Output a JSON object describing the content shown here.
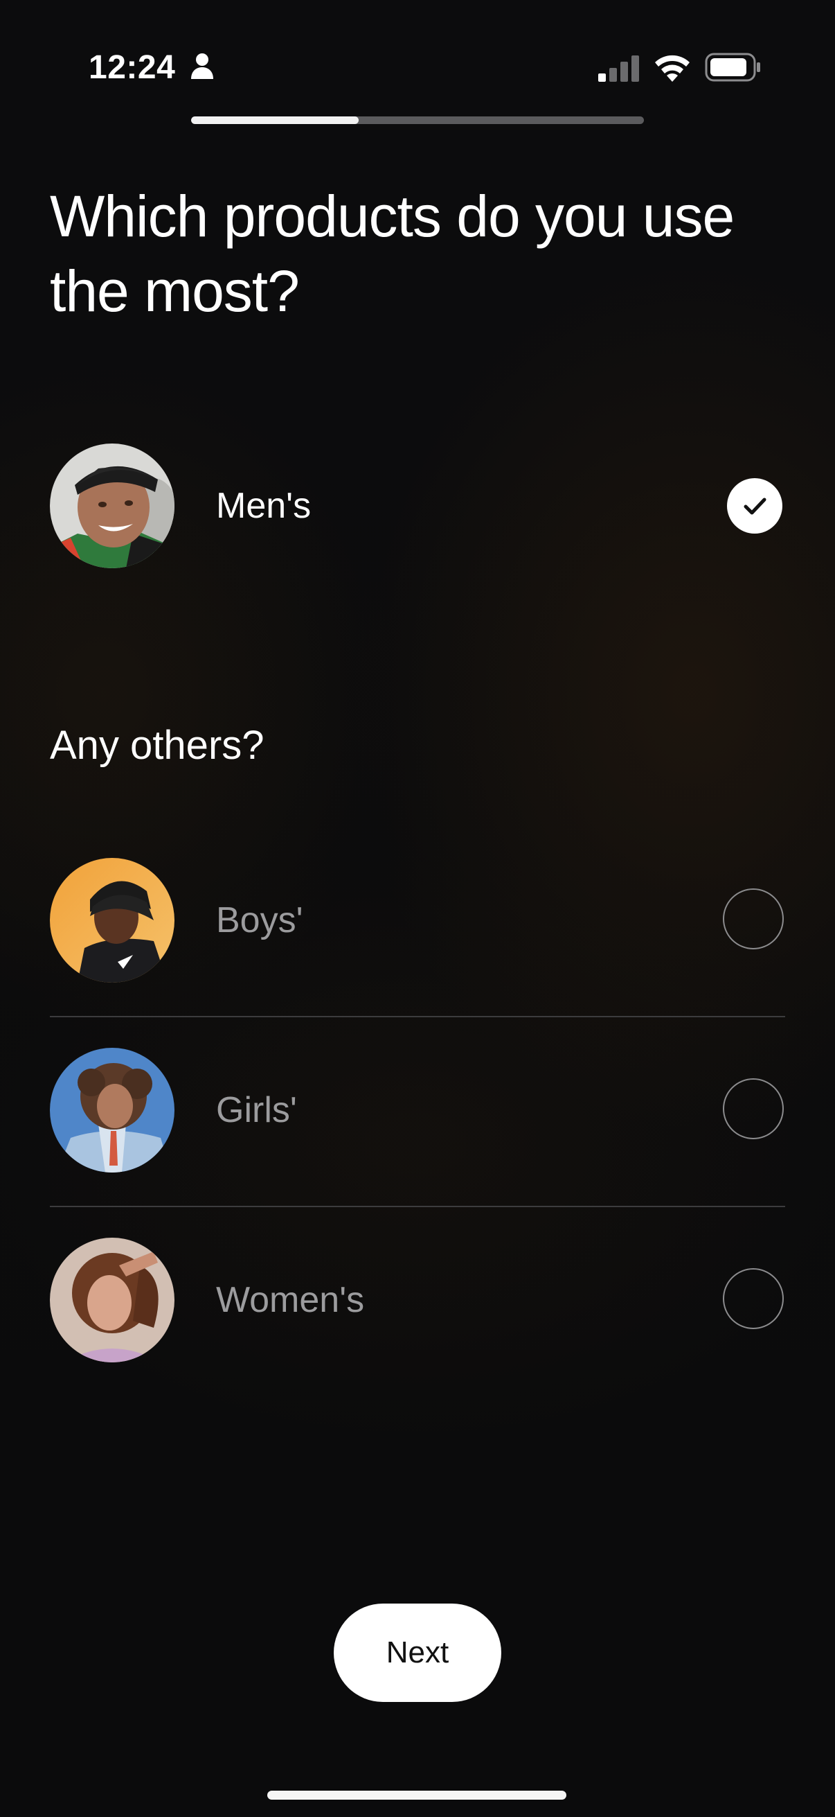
{
  "status_bar": {
    "time": "12:24",
    "icons": [
      "person-icon",
      "cellular-signal-icon",
      "wifi-icon",
      "battery-icon"
    ]
  },
  "progress": {
    "value": 0.37
  },
  "title": "Which products do you use the most?",
  "primary_option": {
    "label": "Men's",
    "selected": true,
    "icon": "checkmark-icon"
  },
  "others_heading": "Any others?",
  "other_options": [
    {
      "label": "Boys'",
      "selected": false
    },
    {
      "label": "Girls'",
      "selected": false
    },
    {
      "label": "Women's",
      "selected": false
    }
  ],
  "next_button": {
    "label": "Next"
  },
  "colors": {
    "background": "#0b0b0c",
    "selected_text": "#ffffff",
    "unselected_text": "#9c9c9e",
    "divider": "#3c3c3e",
    "button_bg": "#ffffff",
    "button_text": "#111111"
  }
}
